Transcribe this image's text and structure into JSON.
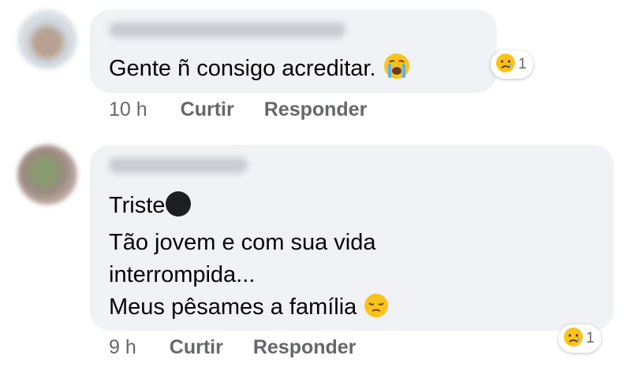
{
  "comments": [
    {
      "text": "Gente ñ  consigo acreditar.",
      "emoji_icon": "loudly-crying-face-icon",
      "reaction": {
        "icon": "sad-face-icon",
        "count": "1"
      },
      "actions": {
        "time": "10 h",
        "like": "Curtir",
        "reply": "Responder"
      }
    },
    {
      "lines": [
        "Triste",
        "Tão jovem e com sua vida",
        "interrompida...",
        "Meus pêsames a família"
      ],
      "emoji_icons": [
        "black-circle-icon",
        "pensive-face-icon"
      ],
      "reaction": {
        "icon": "sad-face-icon",
        "count": "1"
      },
      "actions": {
        "time": "9 h",
        "like": "Curtir",
        "reply": "Responder"
      }
    }
  ],
  "colors": {
    "bubble": "#f0f2f5",
    "text": "#050505",
    "secondary": "#65676b",
    "emoji_yellow": "#fcc21b"
  }
}
